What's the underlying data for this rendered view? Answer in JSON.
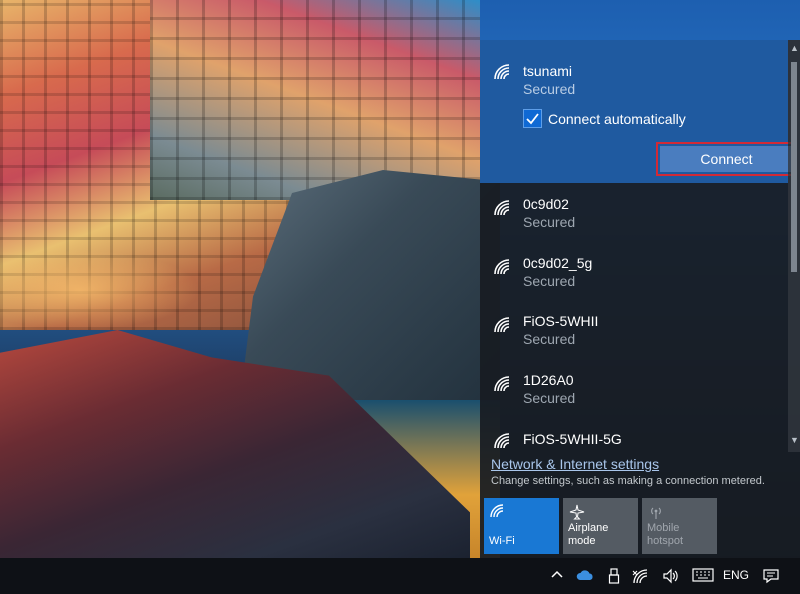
{
  "flyout": {
    "selected_network": {
      "name": "tsunami",
      "status": "Secured",
      "connect_automatically_label": "Connect automatically",
      "connect_automatically_checked": true,
      "connect_button_label": "Connect"
    },
    "networks": [
      {
        "name": "0c9d02",
        "status": "Secured"
      },
      {
        "name": "0c9d02_5g",
        "status": "Secured"
      },
      {
        "name": "FiOS-5WHII",
        "status": "Secured"
      },
      {
        "name": "1D26A0",
        "status": "Secured"
      },
      {
        "name": "FiOS-5WHII-5G",
        "status": ""
      }
    ],
    "settings_link": "Network & Internet settings",
    "settings_description": "Change settings, such as making a connection metered.",
    "quick_actions": {
      "wifi": {
        "line1": "Wi-Fi",
        "line2": ""
      },
      "airplane": {
        "line1": "Airplane mode",
        "line2": ""
      },
      "hotspot": {
        "line1": "Mobile",
        "line2": "hotspot"
      }
    }
  },
  "taskbar": {
    "language": "ENG"
  },
  "colors": {
    "accent": "#1f5aa0",
    "connect_button": "#4a7dbf",
    "highlight_border": "#d22a36",
    "wifi_tile": "#1978d4"
  }
}
